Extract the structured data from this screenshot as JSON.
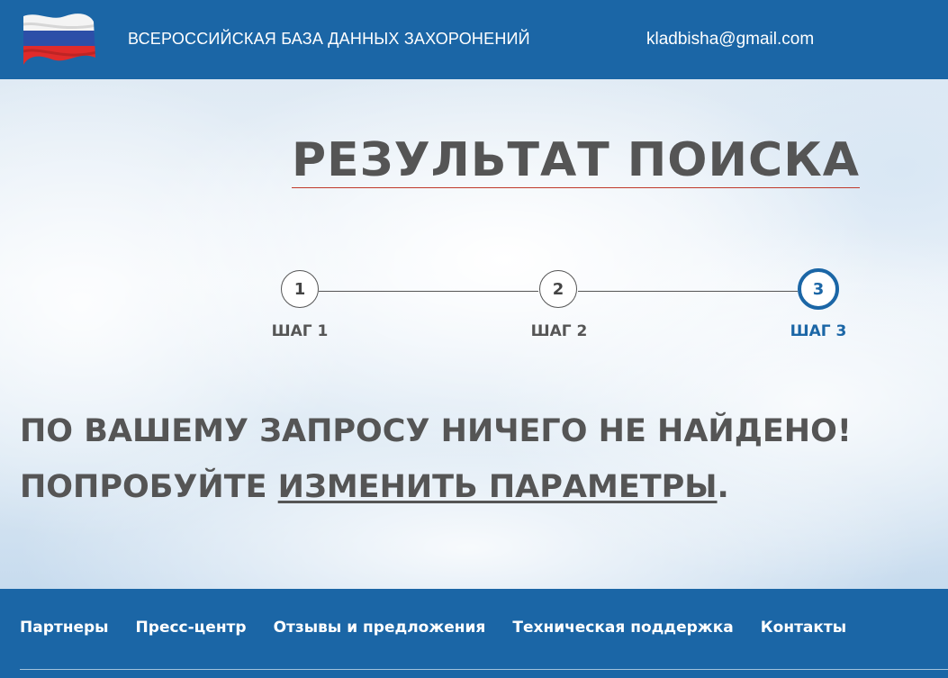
{
  "header": {
    "site_title": "ВСЕРОССИЙСКАЯ БАЗА ДАННЫХ ЗАХОРОНЕНИЙ",
    "email": "kladbisha@gmail.com",
    "logo_icon": "russian-flag-icon"
  },
  "main": {
    "title": "РЕЗУЛЬТАТ ПОИСКА",
    "steps": [
      {
        "number": "1",
        "label": "ШАГ 1",
        "active": false
      },
      {
        "number": "2",
        "label": "ШАГ 2",
        "active": false
      },
      {
        "number": "3",
        "label": "ШАГ 3",
        "active": true
      }
    ],
    "message_line1": "ПО ВАШЕМУ ЗАПРОСУ НИЧЕГО НЕ НАЙДЕНО!",
    "message_line2_prefix": "ПОПРОБУЙТЕ ",
    "message_link": "ИЗМЕНИТЬ ПАРАМЕТРЫ",
    "message_line2_suffix": "."
  },
  "footer": {
    "links": [
      "Партнеры",
      "Пресс-центр",
      "Отзывы и предложения",
      "Техническая поддержка",
      "Контакты"
    ]
  },
  "colors": {
    "brand_blue": "#1b66a6",
    "text_gray": "#555555",
    "title_underline": "#c0392b"
  }
}
